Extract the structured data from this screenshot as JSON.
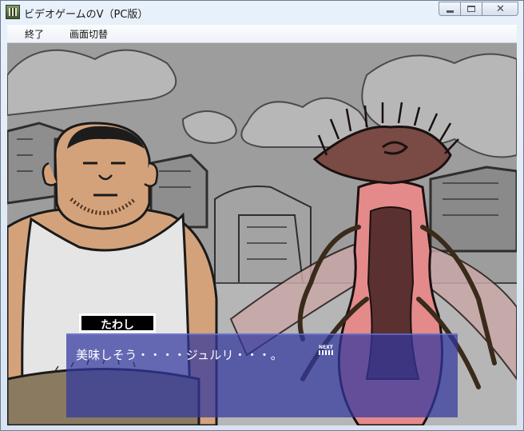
{
  "window": {
    "title": "ビデオゲームのV（PC版）",
    "caption_close": "✕"
  },
  "menu": {
    "items": [
      {
        "label": "終了"
      },
      {
        "label": "画面切替"
      }
    ]
  },
  "dialogue": {
    "speaker": "たわし",
    "message": "美味しそう・・・・ジュルリ・・・。",
    "next_label": "NEXT"
  },
  "colors": {
    "message_box": "#3237a0",
    "name_box": "#000000",
    "insect_body": "#e58a8a",
    "skin": "#d4a27a"
  }
}
